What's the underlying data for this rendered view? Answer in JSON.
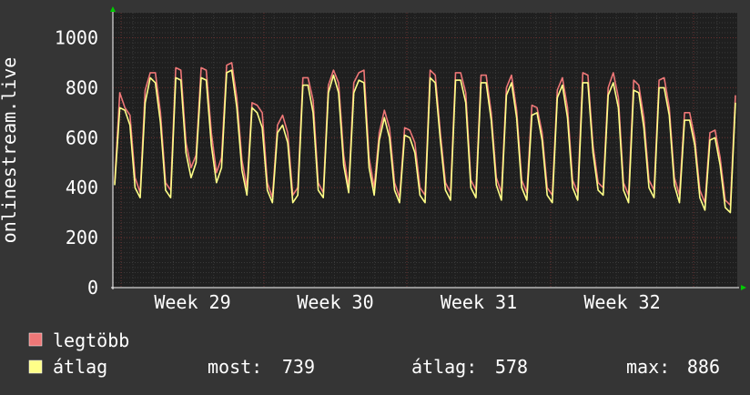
{
  "chart_data": {
    "type": "line",
    "ylabel": "onlinestream.live",
    "ylim": [
      0,
      1100
    ],
    "y_ticks": [
      "0",
      "200",
      "400",
      "600",
      "800",
      "1000"
    ],
    "x_ticks": [
      "Week 29",
      "Week 30",
      "Week 31",
      "Week 32"
    ],
    "grid": true,
    "colors": {
      "background": "#353535",
      "plot_background": "#1f1f1f",
      "minor_grid": "#3a3a3a",
      "major_grid": "#6a3030",
      "axis": "#ffffff",
      "arrow": "#00cc00",
      "max_series": "#ee7777",
      "avg_series": "#ffff88"
    },
    "series": [
      {
        "name": "legtöbb",
        "values": [
          420,
          780,
          720,
          690,
          440,
          380,
          790,
          860,
          860,
          700,
          420,
          390,
          880,
          870,
          580,
          480,
          530,
          880,
          870,
          620,
          460,
          520,
          890,
          900,
          760,
          510,
          400,
          740,
          730,
          700,
          420,
          360,
          650,
          690,
          620,
          370,
          400,
          840,
          840,
          750,
          420,
          380,
          810,
          870,
          820,
          530,
          400,
          820,
          860,
          870,
          520,
          400,
          620,
          710,
          640,
          420,
          360,
          640,
          630,
          580,
          400,
          370,
          870,
          850,
          620,
          420,
          380,
          860,
          860,
          780,
          430,
          390,
          850,
          850,
          700,
          440,
          380,
          800,
          850,
          710,
          430,
          380,
          730,
          720,
          620,
          400,
          370,
          790,
          840,
          720,
          430,
          380,
          860,
          850,
          570,
          420,
          400,
          800,
          860,
          760,
          420,
          370,
          830,
          810,
          680,
          430,
          390,
          830,
          840,
          720,
          440,
          370,
          700,
          700,
          600,
          390,
          340,
          620,
          630,
          520,
          350,
          330,
          770
        ],
        "legend_label": "legtöbb"
      },
      {
        "name": "átlag",
        "values": [
          410,
          720,
          710,
          650,
          400,
          360,
          740,
          840,
          820,
          660,
          390,
          360,
          840,
          830,
          540,
          440,
          500,
          840,
          830,
          570,
          420,
          480,
          860,
          870,
          720,
          470,
          370,
          720,
          700,
          640,
          390,
          340,
          620,
          650,
          580,
          340,
          370,
          810,
          810,
          700,
          390,
          360,
          780,
          850,
          780,
          490,
          380,
          780,
          830,
          820,
          480,
          370,
          590,
          680,
          600,
          390,
          340,
          610,
          600,
          540,
          370,
          340,
          840,
          820,
          590,
          390,
          350,
          830,
          830,
          740,
          400,
          360,
          820,
          820,
          670,
          410,
          350,
          770,
          820,
          680,
          400,
          350,
          690,
          700,
          590,
          370,
          340,
          760,
          810,
          680,
          400,
          350,
          820,
          820,
          540,
          390,
          370,
          770,
          820,
          720,
          390,
          340,
          790,
          780,
          640,
          400,
          360,
          800,
          800,
          690,
          410,
          340,
          670,
          670,
          570,
          360,
          310,
          590,
          600,
          490,
          320,
          300,
          740
        ],
        "legend_label": "átlag"
      }
    ],
    "stats": {
      "most_label": "most:",
      "most_value": "739",
      "avg_label": "átlag:",
      "avg_value": "578",
      "max_label": "max:",
      "max_value": "886"
    }
  }
}
